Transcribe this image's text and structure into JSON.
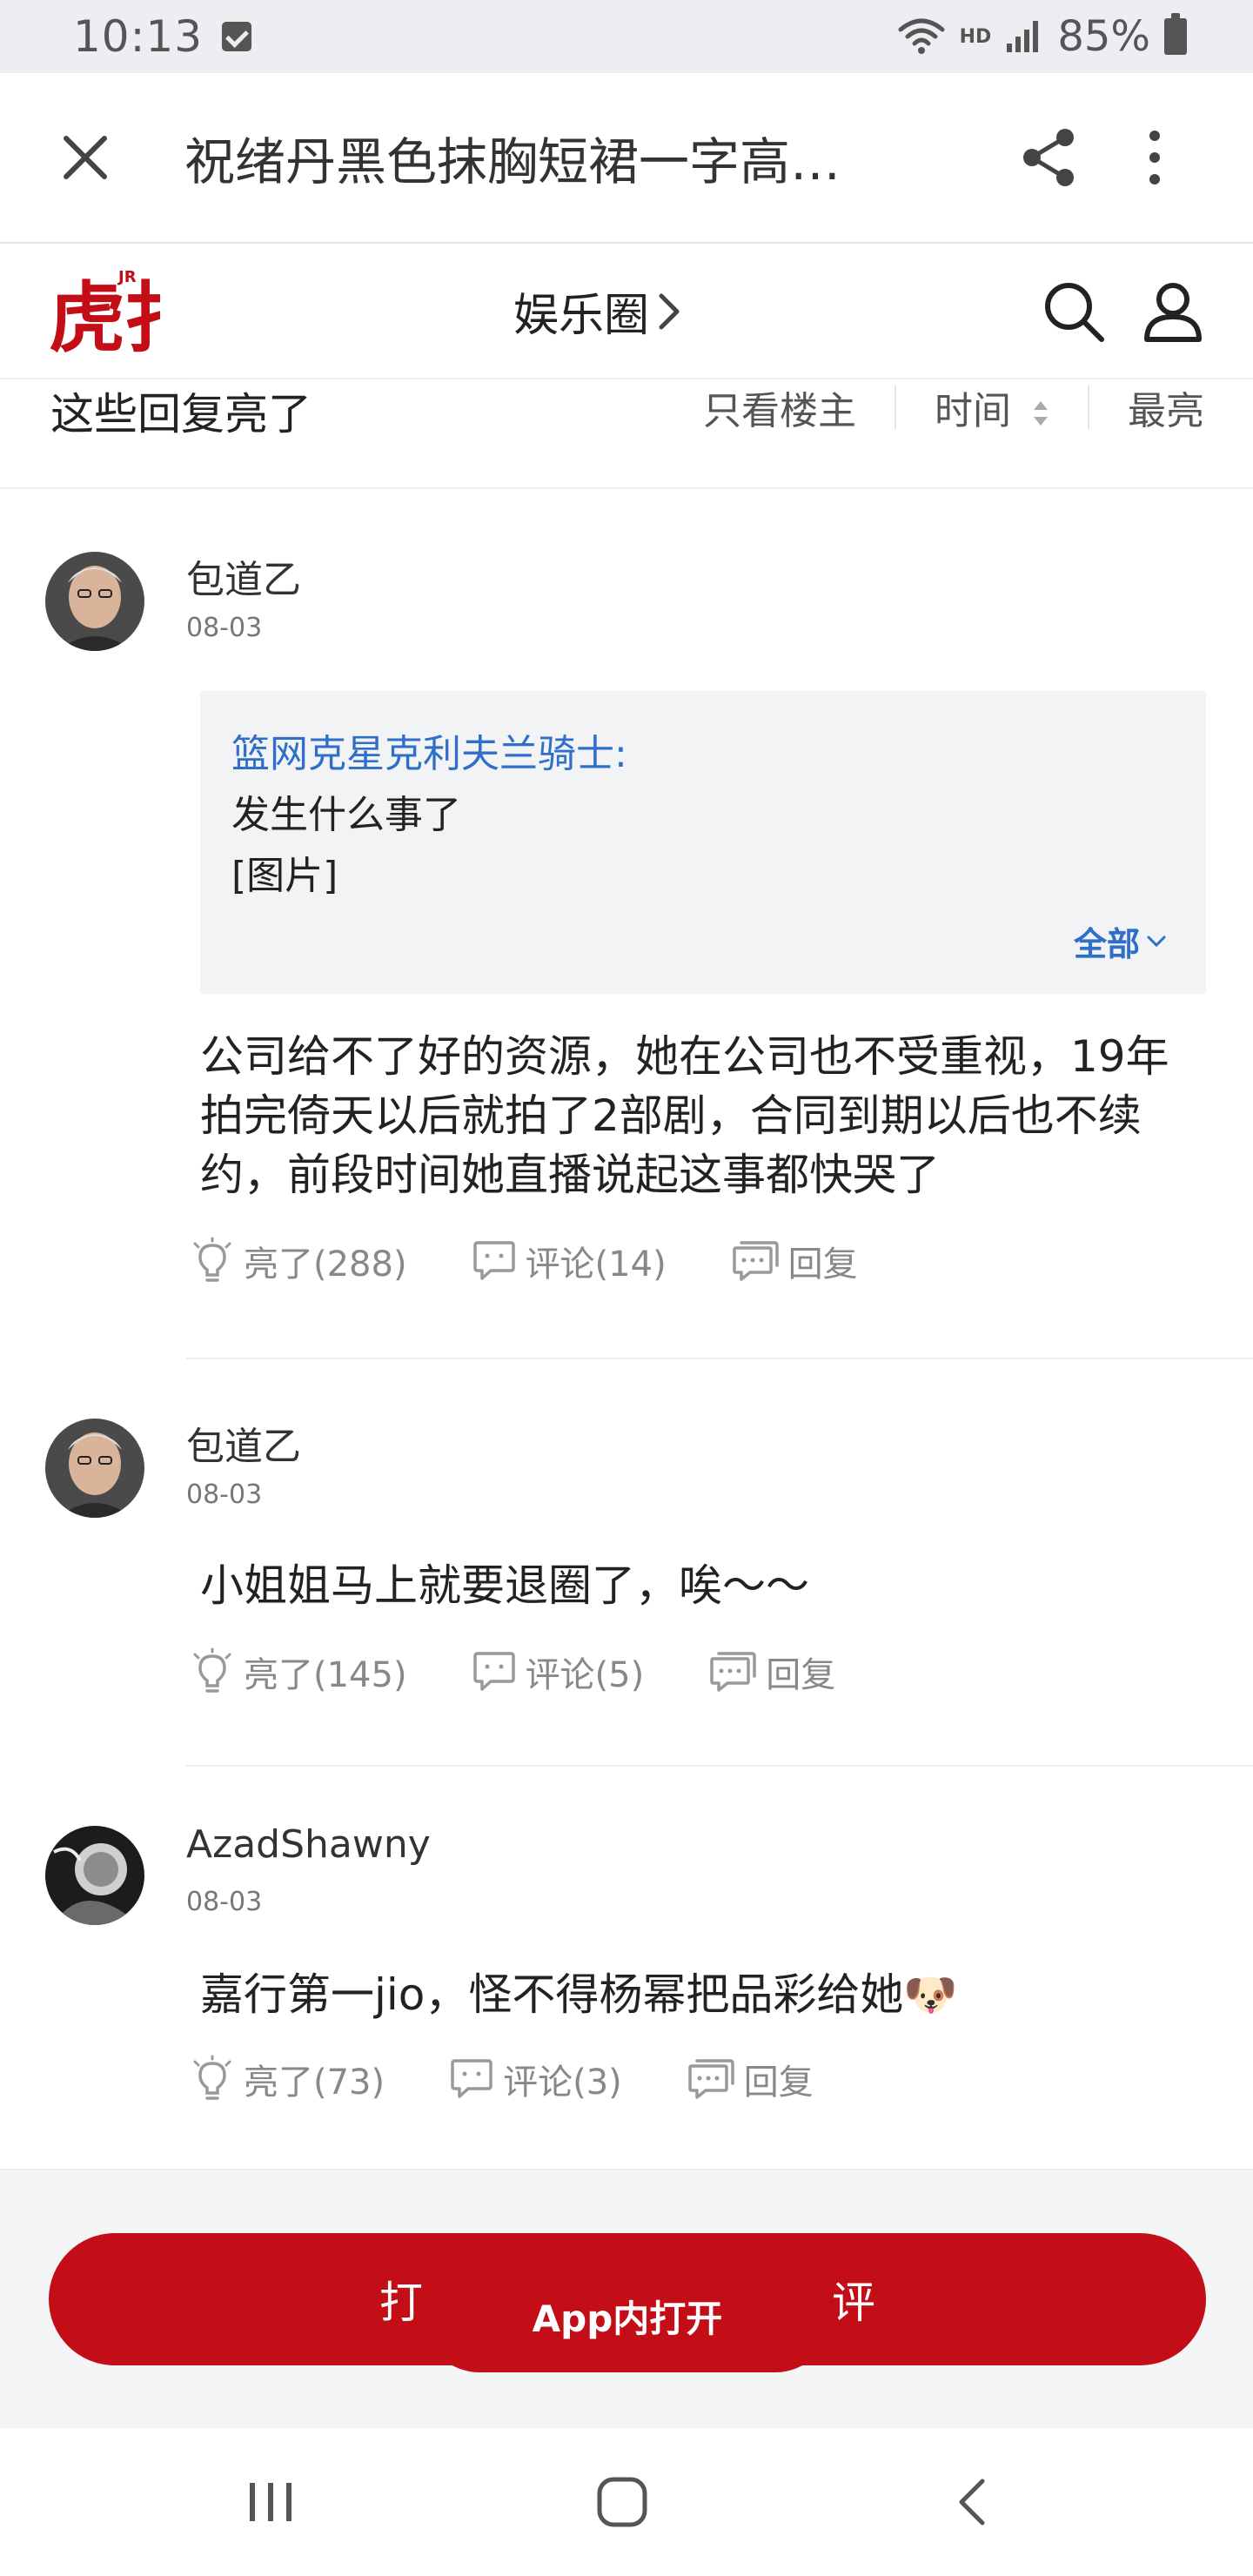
{
  "status_bar": {
    "time": "10:13",
    "network_label": "HD",
    "battery": "85%"
  },
  "browser": {
    "title": "祝绪丹黑色抹胸短裙一字高…",
    "icons": [
      "close-icon",
      "share-icon",
      "more-vertical-icon"
    ]
  },
  "site_header": {
    "logo_text": "虎扑",
    "logo_badge": "JR",
    "section": "娱乐圈",
    "icons": [
      "search-icon",
      "user-icon"
    ]
  },
  "filter": {
    "heading": "这些回复亮了",
    "op_only": "只看楼主",
    "time": "时间",
    "hot": "最亮"
  },
  "comments": [
    {
      "user": "包道乙",
      "date": "08-03",
      "quote": {
        "user": "篮网克星克利夫兰骑士:",
        "line1": "发生什么事了",
        "line2": "[图片]",
        "more": "全部"
      },
      "text": "公司给不了好的资源，她在公司也不受重视，19年拍完倚天以后就拍了2部剧，合同到期以后也不续约，前段时间她直播说起这事都快哭了",
      "likes": "亮了(288)",
      "comments": "评论(14)",
      "reply": "回复"
    },
    {
      "user": "包道乙",
      "date": "08-03",
      "text": "小姐姐马上就要退圈了，唉～～",
      "likes": "亮了(145)",
      "comments": "评论(5)",
      "reply": "回复"
    },
    {
      "user": "AzadShawny",
      "date": "08-03",
      "text": "嘉行第一jio，怪不得杨幂把品彩给她",
      "emoji": "🐶",
      "likes": "亮了(73)",
      "comments": "评论(3)",
      "reply": "回复"
    }
  ],
  "bottom_bar": {
    "left_label": "打",
    "open_app": "App内打开",
    "right_label": "评"
  },
  "colors": {
    "brand_red": "#c30d17",
    "link_blue": "#2f6ec9",
    "status_bg": "#eceef1"
  },
  "nav_icons": [
    "recents-icon",
    "home-icon",
    "back-icon"
  ]
}
